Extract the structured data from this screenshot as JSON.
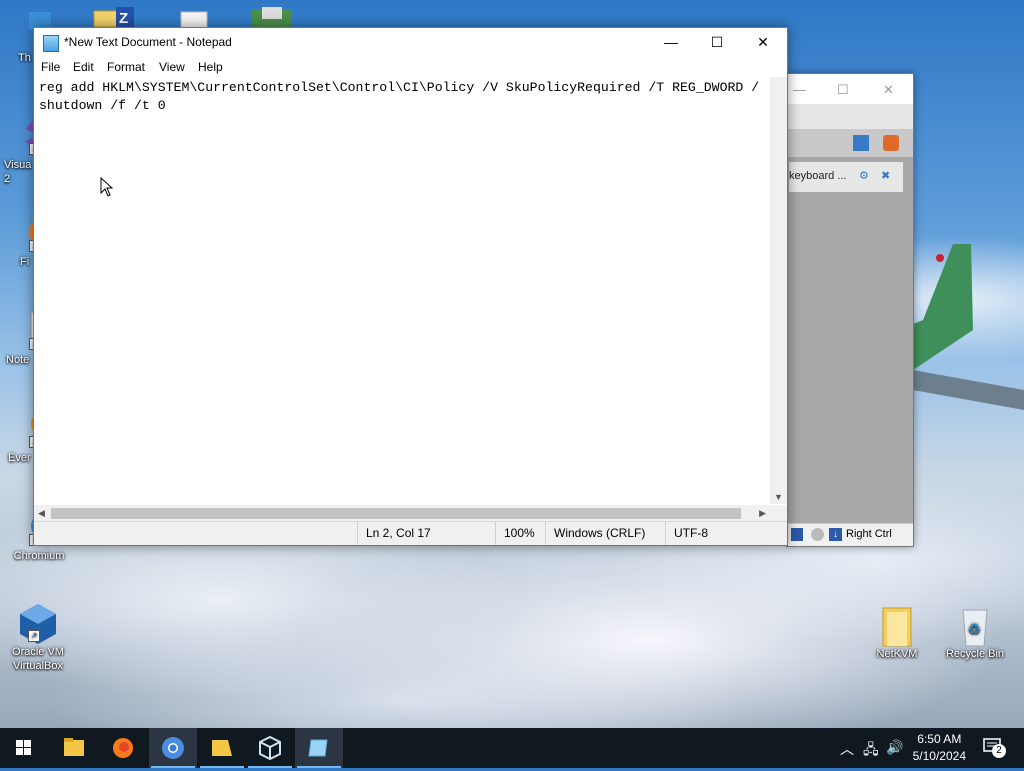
{
  "desktop": {
    "icons": [
      {
        "label": "Th",
        "icon": "this-pc-icon"
      },
      {
        "label": "Visua\n2",
        "icon": "visual-studio-icon"
      },
      {
        "label": "Fi",
        "icon": "firefox-icon"
      },
      {
        "label": "Note",
        "icon": "notepadpp-icon"
      },
      {
        "label": "Ever",
        "icon": "everything-icon"
      },
      {
        "label": "Chromium",
        "icon": "chromium-icon"
      },
      {
        "label": "Oracle VM VirtualBox",
        "icon": "virtualbox-icon"
      },
      {
        "label": "NetKVM",
        "icon": "folder-icon"
      },
      {
        "label": "Recycle Bin",
        "icon": "recycle-bin-icon"
      }
    ]
  },
  "virtualbox_window": {
    "item_label": "keyboard ...",
    "status_text": "Right Ctrl"
  },
  "notepad": {
    "title": "*New Text Document - Notepad",
    "menu": [
      "File",
      "Edit",
      "Format",
      "View",
      "Help"
    ],
    "content": "reg add HKLM\\SYSTEM\\CurrentControlSet\\Control\\CI\\Policy /V SkuPolicyRequired /T REG_DWORD /\nshutdown /f /t 0",
    "status": {
      "position": "Ln 2, Col 17",
      "zoom": "100%",
      "line_ending": "Windows (CRLF)",
      "encoding": "UTF-8"
    },
    "controls": {
      "minimize": "—",
      "maximize": "☐",
      "close": "✕"
    }
  },
  "taskbar": {
    "apps": [
      "start",
      "file-explorer",
      "firefox",
      "chromium",
      "folder",
      "virtualbox",
      "notepad"
    ],
    "clock": {
      "time": "6:50 AM",
      "date": "5/10/2024"
    },
    "notification_count": "2"
  }
}
